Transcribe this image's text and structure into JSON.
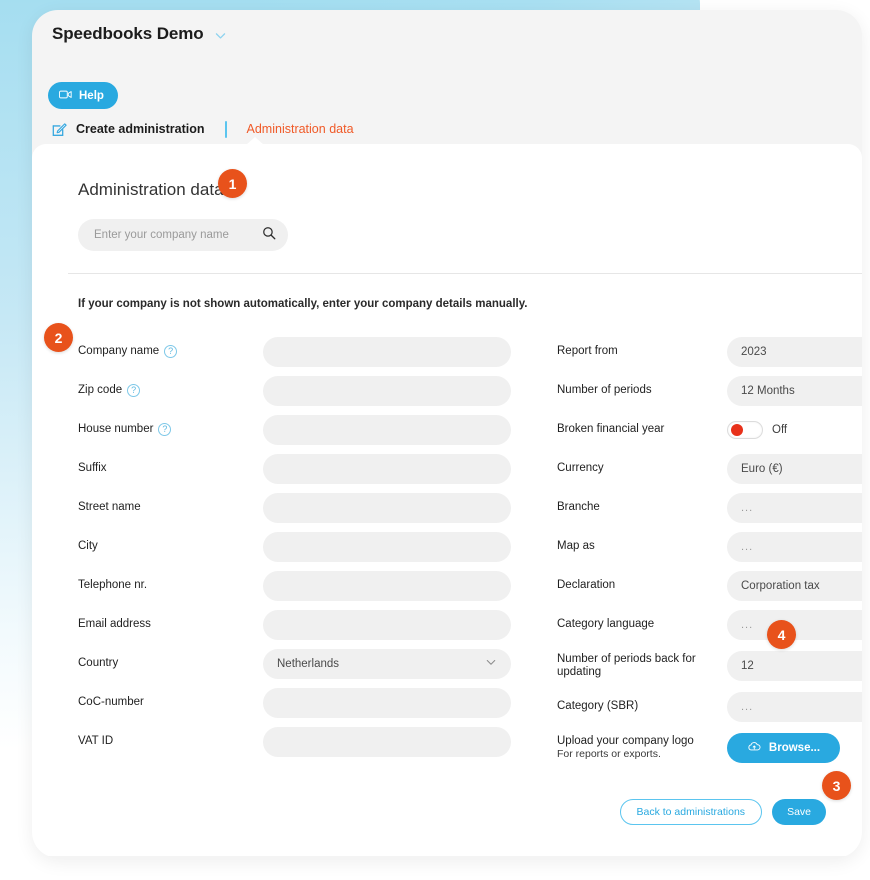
{
  "app": {
    "title": "Speedbooks Demo",
    "chevron_icon": "chevron-down-icon",
    "help_label": "Help",
    "help_icon": "video-camera-icon"
  },
  "tabs": {
    "create_icon": "edit-square-icon",
    "create_label": "Create administration",
    "admin_label": "Administration data"
  },
  "panel": {
    "section_title": "Administration data",
    "search_placeholder": "Enter your company name",
    "search_value": "",
    "search_icon": "search-icon",
    "hint": "If your company is not shown automatically, enter your company details manually."
  },
  "left_fields": [
    {
      "label": "Company name",
      "help": true,
      "value": "",
      "type": "text"
    },
    {
      "label": "Zip code",
      "help": true,
      "value": "",
      "type": "text"
    },
    {
      "label": "House number",
      "help": true,
      "value": "",
      "type": "text"
    },
    {
      "label": "Suffix",
      "help": false,
      "value": "",
      "type": "text"
    },
    {
      "label": "Street name",
      "help": false,
      "value": "",
      "type": "text"
    },
    {
      "label": "City",
      "help": false,
      "value": "",
      "type": "text"
    },
    {
      "label": "Telephone nr.",
      "help": false,
      "value": "",
      "type": "text"
    },
    {
      "label": "Email address",
      "help": false,
      "value": "",
      "type": "text"
    },
    {
      "label": "Country",
      "help": false,
      "value": "Netherlands",
      "type": "select"
    },
    {
      "label": "CoC-number",
      "help": false,
      "value": "",
      "type": "text"
    },
    {
      "label": "VAT ID",
      "help": false,
      "value": "",
      "type": "text"
    }
  ],
  "right_fields": [
    {
      "label": "Report from",
      "value": "2023",
      "type": "text"
    },
    {
      "label": "Number of periods",
      "value": "12 Months",
      "type": "text"
    },
    {
      "label": "Broken financial year",
      "value": "Off",
      "type": "toggle",
      "toggle_state": "off"
    },
    {
      "label": "Currency",
      "value": "Euro (€)",
      "type": "text"
    },
    {
      "label": "Branche",
      "value": "...",
      "type": "empty"
    },
    {
      "label": "Map as",
      "value": "...",
      "type": "empty"
    },
    {
      "label": "Declaration",
      "value": "Corporation tax",
      "type": "text"
    },
    {
      "label": "Category language",
      "value": "...",
      "type": "empty"
    },
    {
      "label": "Number of periods back for updating",
      "value": "12",
      "type": "text"
    },
    {
      "label": "Category (SBR)",
      "value": "...",
      "type": "empty"
    }
  ],
  "upload": {
    "label": "Upload your company logo",
    "sub_label": "For reports or exports.",
    "button_label": "Browse...",
    "button_icon": "cloud-upload-icon"
  },
  "footer": {
    "back_label": "Back to administrations",
    "save_label": "Save"
  },
  "badges": {
    "one": "1",
    "two": "2",
    "three": "3",
    "four": "4"
  },
  "colors": {
    "accent_blue": "#29a9e0",
    "badge_orange": "#e8521b",
    "tab_orange": "#f05a28",
    "toggle_red": "#e8311a",
    "field_grey": "#f0f0f0"
  }
}
